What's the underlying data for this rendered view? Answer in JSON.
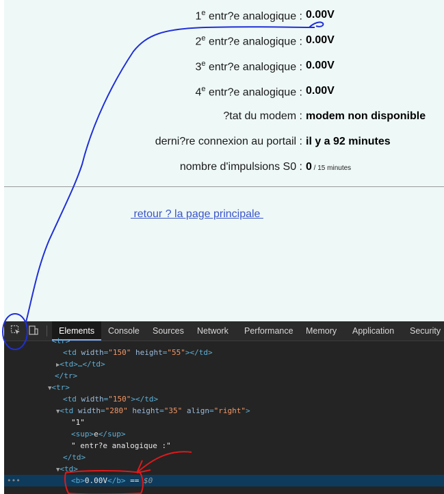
{
  "page": {
    "rows": [
      {
        "num": "1",
        "sup": "e",
        "label": " entr?e analogique : ",
        "value": "0.00V"
      },
      {
        "num": "2",
        "sup": "e",
        "label": " entr?e analogique : ",
        "value": "0.00V"
      },
      {
        "num": "3",
        "sup": "e",
        "label": " entr?e analogique : ",
        "value": "0.00V"
      },
      {
        "num": "4",
        "sup": "e",
        "label": " entr?e analogique : ",
        "value": "0.00V"
      }
    ],
    "modem_label": "?tat du modem : ",
    "modem_value": "modem non disponible",
    "portal_label": "derni?re connexion au portail : ",
    "portal_value": "il y a 92 minutes",
    "pulses_label": "nombre d'impulsions S0 : ",
    "pulses_value": "0",
    "pulses_unit": " / 15 minutes",
    "back_link": " retour ? la page principale "
  },
  "devtools": {
    "tabs": [
      "Elements",
      "Console",
      "Sources",
      "Network",
      "Performance",
      "Memory",
      "Application",
      "Security"
    ],
    "active_tab": "Elements",
    "icons": [
      "inspect-element-icon",
      "device-toolbar-icon"
    ],
    "dom": {
      "l1": "<tr>",
      "l2_open": "<td ",
      "l2_attr_w": "width",
      "l2_val_w": "\"150\"",
      "l2_attr_h": "height",
      "l2_val_h": "\"55\"",
      "l2_close": "></td>",
      "l3": "<td>…</td>",
      "l4": "</tr>",
      "l5": "<tr>",
      "l6_open": "<td ",
      "l6_attr_w": "width",
      "l6_val_w": "\"150\"",
      "l6_close": "></td>",
      "l7_open": "<td ",
      "l7_attr_w": "width",
      "l7_val_w": "\"280\"",
      "l7_attr_h": "height",
      "l7_val_h": "\"35\"",
      "l7_attr_a": "align",
      "l7_val_a": "\"right\"",
      "l7_close": ">",
      "l8": "\"1\"",
      "l9_open": "<sup>",
      "l9_text": "e",
      "l9_close": "</sup>",
      "l10": "\" entr?e analogique :\"",
      "l11": "</td>",
      "l12": "<td>",
      "l13_open": "<b>",
      "l13_text": "0.00V",
      "l13_close": "</b>",
      "l13_eq": " == ",
      "l13_ref": "$0",
      "ellipsis": "•••"
    }
  },
  "annotation_colors": {
    "blue_line": "#1f2fd6",
    "red_arrow": "#e0191b"
  }
}
